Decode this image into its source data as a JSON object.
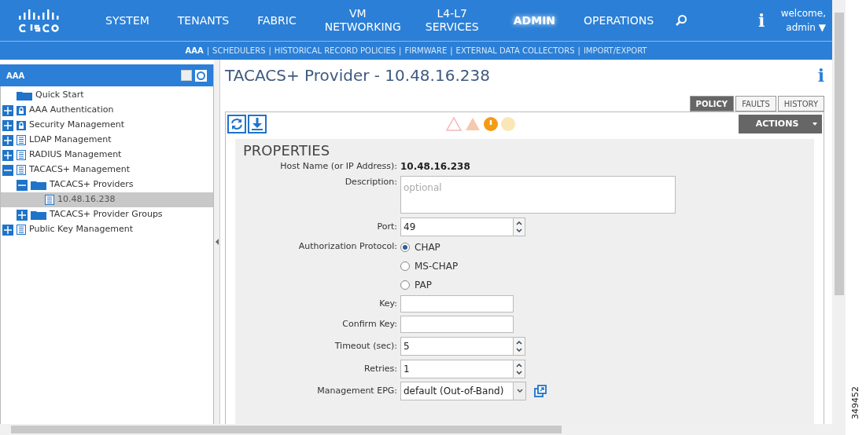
{
  "nav": {
    "items": [
      {
        "label": "SYSTEM",
        "selected": false
      },
      {
        "label": "TENANTS",
        "selected": false
      },
      {
        "label": "FABRIC",
        "selected": false
      },
      {
        "label": "VM NETWORKING",
        "selected": false
      },
      {
        "label": "L4-L7 SERVICES",
        "selected": false
      },
      {
        "label": "ADMIN",
        "selected": true
      },
      {
        "label": "OPERATIONS",
        "selected": false
      }
    ],
    "info": "i",
    "welcome": "welcome,",
    "user": "admin ▼"
  },
  "subnav": [
    {
      "label": "AAA",
      "selected": true
    },
    {
      "separator": "|",
      "label": "SCHEDULERS",
      "selected": false
    },
    {
      "separator": "|",
      "label": "HISTORICAL RECORD POLICIES",
      "selected": false
    },
    {
      "separator": "|",
      "label": "FIRMWARE",
      "selected": false
    },
    {
      "separator": "|",
      "label": "EXTERNAL DATA COLLECTORS",
      "selected": false
    },
    {
      "separator": "|",
      "label": "IMPORT/EXPORT",
      "selected": false
    }
  ],
  "sidebar": {
    "title": "AAA",
    "tree": [
      {
        "label": "Quick Start",
        "kind": "folder",
        "selected": false
      },
      {
        "label": "AAA Authentication",
        "kind": "lock",
        "expanded": false,
        "selected": false
      },
      {
        "label": "Security Management",
        "kind": "lock",
        "expanded": false,
        "selected": false
      },
      {
        "label": "LDAP Management",
        "kind": "doc",
        "expanded": false,
        "selected": false
      },
      {
        "label": "RADIUS Management",
        "kind": "doc",
        "expanded": false,
        "selected": false
      },
      {
        "label": "TACACS+ Management",
        "kind": "doc",
        "expanded": true,
        "selected": false,
        "children": [
          {
            "label": "TACACS+ Providers",
            "kind": "folder",
            "expanded": true,
            "selected": false,
            "children": [
              {
                "label": "10.48.16.238",
                "kind": "doc",
                "selected": true
              }
            ]
          },
          {
            "label": "TACACS+ Provider Groups",
            "kind": "folder",
            "expanded": false,
            "selected": false
          }
        ]
      },
      {
        "label": "Public Key Management",
        "kind": "doc",
        "expanded": false,
        "selected": false
      }
    ]
  },
  "main": {
    "title": "TACACS+ Provider - 10.48.16.238",
    "info": "i",
    "tabs": [
      {
        "label": "POLICY",
        "selected": true
      },
      {
        "label": "FAULTS",
        "selected": false
      },
      {
        "label": "HISTORY",
        "selected": false
      }
    ],
    "actions": "ACTIONS",
    "section": "PROPERTIES",
    "fields": [
      {
        "kind": "static",
        "label": "Host Name (or IP Address):",
        "value": "10.48.16.238"
      },
      {
        "kind": "textarea",
        "label": "Description:",
        "placeholder": "optional"
      },
      {
        "kind": "spinner",
        "label": "Port:",
        "value": "49"
      },
      {
        "kind": "radio",
        "label": "Authorization Protocol:",
        "options": [
          {
            "label": "CHAP",
            "selected": true
          },
          {
            "label": "MS-CHAP",
            "selected": false
          },
          {
            "label": "PAP",
            "selected": false
          }
        ]
      },
      {
        "kind": "text",
        "label": "Key:"
      },
      {
        "kind": "text",
        "label": "Confirm Key:"
      },
      {
        "kind": "spinner",
        "label": "Timeout (sec):",
        "value": "5"
      },
      {
        "kind": "spinner",
        "label": "Retries:",
        "value": "1"
      },
      {
        "kind": "select",
        "label": "Management EPG:",
        "value": "default (Out-of-Band)"
      }
    ]
  },
  "figure_number": "349452"
}
